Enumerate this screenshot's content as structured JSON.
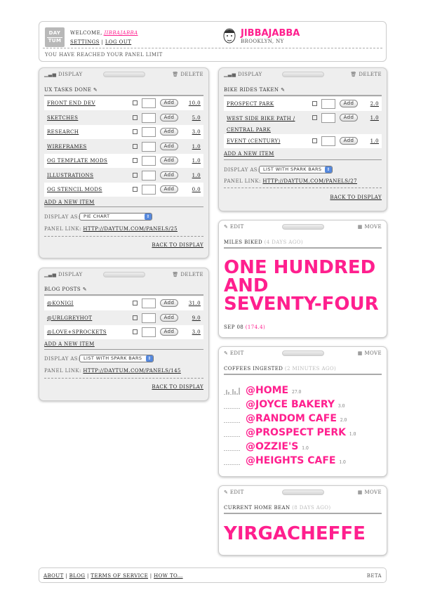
{
  "header": {
    "logo_top": "DAY",
    "logo_bottom": "TUM",
    "welcome": "WELCOME,",
    "username_link": "JIBBAJABBA",
    "settings": "SETTINGS",
    "logout": "LOG OUT",
    "name": "JIBBAJABBA",
    "location": "BROOKLYN, NY",
    "limit": "YOU HAVE REACHED YOUR PANEL LIMIT"
  },
  "common": {
    "display": "DISPLAY",
    "delete": "DELETE",
    "edit": "EDIT",
    "move": "MOVE",
    "add": "Add",
    "add_new": "ADD A NEW ITEM",
    "display_as": "DISPLAY AS:",
    "panel_link": "PANEL LINK:",
    "back": "BACK TO DISPLAY"
  },
  "ux_panel": {
    "title": "UX TASKS DONE",
    "items": [
      {
        "label": "FRONT END DEV",
        "value": "10.0"
      },
      {
        "label": "SKETCHES",
        "value": "5.0"
      },
      {
        "label": "RESEARCH",
        "value": "3.0"
      },
      {
        "label": "WIREFRAMES",
        "value": "1.0"
      },
      {
        "label": "OG TEMPLATE MODS",
        "value": "1.0"
      },
      {
        "label": "ILLUSTRATIONS",
        "value": "1.0"
      },
      {
        "label": "OG STENCIL MODS",
        "value": "0.0"
      }
    ],
    "display_as": "PIE CHART",
    "link": "HTTP://DAYTUM.COM/PANELS/25"
  },
  "blog_panel": {
    "title": "BLOG POSTS",
    "items": [
      {
        "label": "@KONIGI",
        "value": "31.0"
      },
      {
        "label": "@URLGREYHOT",
        "value": "9.0"
      },
      {
        "label": "@LOVE+SPROCKETS",
        "value": "3.0"
      }
    ],
    "display_as": "LIST WITH SPARK BARS",
    "link": "HTTP://DAYTUM.COM/PANELS/145"
  },
  "bike_panel": {
    "title": "BIKE RIDES TAKEN",
    "items": [
      {
        "label": "PROSPECT PARK",
        "value": "2.0"
      },
      {
        "label": "WEST SIDE BIKE PATH /",
        "label2": "CENTRAL PARK",
        "value": "1.0"
      },
      {
        "label": "EVENT (CENTURY)",
        "value": "1.0"
      }
    ],
    "display_as": "LIST WITH SPARK BARS",
    "link": "HTTP://DAYTUM.COM/PANELS/27"
  },
  "miles_panel": {
    "title": "MILES BIKED",
    "ago": "(4 DAYS AGO)",
    "line1": "ONE HUNDRED",
    "line2": "AND",
    "line3": "SEVENTY-FOUR",
    "date": "SEP 08",
    "value": "(174.4)"
  },
  "coffee_panel": {
    "title": "COFFEES INGESTED",
    "ago": "(2 MINUTES AGO)",
    "items": [
      {
        "label": "@HOME",
        "value": "27.0"
      },
      {
        "label": "@JOYCE BAKERY",
        "value": "3.0"
      },
      {
        "label": "@RANDOM CAFE",
        "value": "2.0"
      },
      {
        "label": "@PROSPECT PERK",
        "value": "1.0"
      },
      {
        "label": "@OZZIE'S",
        "value": "1.0"
      },
      {
        "label": "@HEIGHTS CAFE",
        "value": "1.0"
      }
    ]
  },
  "bean_panel": {
    "title": "CURRENT HOME BEAN",
    "ago": "(8 DAYS AGO)",
    "value": "YIRGACHEFFE"
  },
  "footer": {
    "about": "ABOUT",
    "blog": "BLOG",
    "terms": "TERMS OF SERVICE",
    "howto": "HOW TO...",
    "beta": "BETA"
  },
  "colors": {
    "accent": "#ff1f8e",
    "panel_bg": "#eeeeee"
  }
}
